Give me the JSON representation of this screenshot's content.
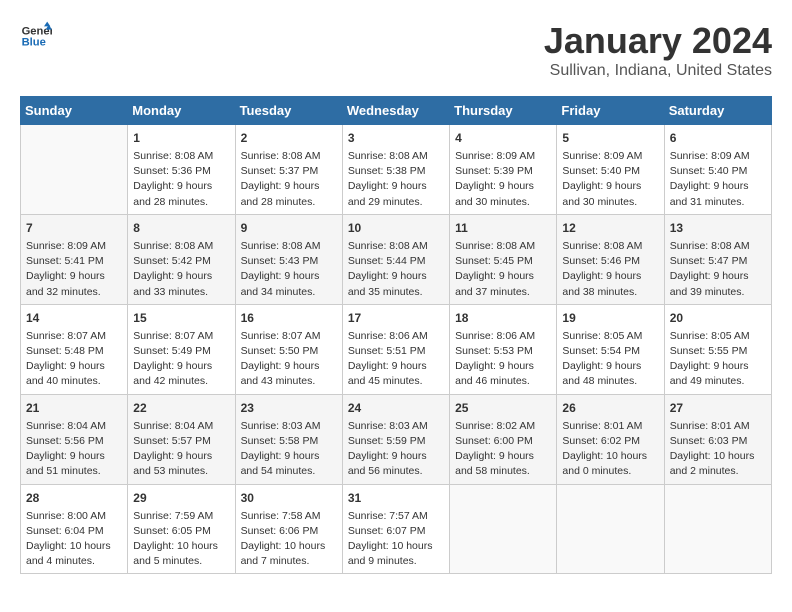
{
  "header": {
    "logo_line1": "General",
    "logo_line2": "Blue",
    "title": "January 2024",
    "subtitle": "Sullivan, Indiana, United States"
  },
  "columns": [
    "Sunday",
    "Monday",
    "Tuesday",
    "Wednesday",
    "Thursday",
    "Friday",
    "Saturday"
  ],
  "weeks": [
    [
      {
        "day": "",
        "info": ""
      },
      {
        "day": "1",
        "info": "Sunrise: 8:08 AM\nSunset: 5:36 PM\nDaylight: 9 hours\nand 28 minutes."
      },
      {
        "day": "2",
        "info": "Sunrise: 8:08 AM\nSunset: 5:37 PM\nDaylight: 9 hours\nand 28 minutes."
      },
      {
        "day": "3",
        "info": "Sunrise: 8:08 AM\nSunset: 5:38 PM\nDaylight: 9 hours\nand 29 minutes."
      },
      {
        "day": "4",
        "info": "Sunrise: 8:09 AM\nSunset: 5:39 PM\nDaylight: 9 hours\nand 30 minutes."
      },
      {
        "day": "5",
        "info": "Sunrise: 8:09 AM\nSunset: 5:40 PM\nDaylight: 9 hours\nand 30 minutes."
      },
      {
        "day": "6",
        "info": "Sunrise: 8:09 AM\nSunset: 5:40 PM\nDaylight: 9 hours\nand 31 minutes."
      }
    ],
    [
      {
        "day": "7",
        "info": "Sunrise: 8:09 AM\nSunset: 5:41 PM\nDaylight: 9 hours\nand 32 minutes."
      },
      {
        "day": "8",
        "info": "Sunrise: 8:08 AM\nSunset: 5:42 PM\nDaylight: 9 hours\nand 33 minutes."
      },
      {
        "day": "9",
        "info": "Sunrise: 8:08 AM\nSunset: 5:43 PM\nDaylight: 9 hours\nand 34 minutes."
      },
      {
        "day": "10",
        "info": "Sunrise: 8:08 AM\nSunset: 5:44 PM\nDaylight: 9 hours\nand 35 minutes."
      },
      {
        "day": "11",
        "info": "Sunrise: 8:08 AM\nSunset: 5:45 PM\nDaylight: 9 hours\nand 37 minutes."
      },
      {
        "day": "12",
        "info": "Sunrise: 8:08 AM\nSunset: 5:46 PM\nDaylight: 9 hours\nand 38 minutes."
      },
      {
        "day": "13",
        "info": "Sunrise: 8:08 AM\nSunset: 5:47 PM\nDaylight: 9 hours\nand 39 minutes."
      }
    ],
    [
      {
        "day": "14",
        "info": "Sunrise: 8:07 AM\nSunset: 5:48 PM\nDaylight: 9 hours\nand 40 minutes."
      },
      {
        "day": "15",
        "info": "Sunrise: 8:07 AM\nSunset: 5:49 PM\nDaylight: 9 hours\nand 42 minutes."
      },
      {
        "day": "16",
        "info": "Sunrise: 8:07 AM\nSunset: 5:50 PM\nDaylight: 9 hours\nand 43 minutes."
      },
      {
        "day": "17",
        "info": "Sunrise: 8:06 AM\nSunset: 5:51 PM\nDaylight: 9 hours\nand 45 minutes."
      },
      {
        "day": "18",
        "info": "Sunrise: 8:06 AM\nSunset: 5:53 PM\nDaylight: 9 hours\nand 46 minutes."
      },
      {
        "day": "19",
        "info": "Sunrise: 8:05 AM\nSunset: 5:54 PM\nDaylight: 9 hours\nand 48 minutes."
      },
      {
        "day": "20",
        "info": "Sunrise: 8:05 AM\nSunset: 5:55 PM\nDaylight: 9 hours\nand 49 minutes."
      }
    ],
    [
      {
        "day": "21",
        "info": "Sunrise: 8:04 AM\nSunset: 5:56 PM\nDaylight: 9 hours\nand 51 minutes."
      },
      {
        "day": "22",
        "info": "Sunrise: 8:04 AM\nSunset: 5:57 PM\nDaylight: 9 hours\nand 53 minutes."
      },
      {
        "day": "23",
        "info": "Sunrise: 8:03 AM\nSunset: 5:58 PM\nDaylight: 9 hours\nand 54 minutes."
      },
      {
        "day": "24",
        "info": "Sunrise: 8:03 AM\nSunset: 5:59 PM\nDaylight: 9 hours\nand 56 minutes."
      },
      {
        "day": "25",
        "info": "Sunrise: 8:02 AM\nSunset: 6:00 PM\nDaylight: 9 hours\nand 58 minutes."
      },
      {
        "day": "26",
        "info": "Sunrise: 8:01 AM\nSunset: 6:02 PM\nDaylight: 10 hours\nand 0 minutes."
      },
      {
        "day": "27",
        "info": "Sunrise: 8:01 AM\nSunset: 6:03 PM\nDaylight: 10 hours\nand 2 minutes."
      }
    ],
    [
      {
        "day": "28",
        "info": "Sunrise: 8:00 AM\nSunset: 6:04 PM\nDaylight: 10 hours\nand 4 minutes."
      },
      {
        "day": "29",
        "info": "Sunrise: 7:59 AM\nSunset: 6:05 PM\nDaylight: 10 hours\nand 5 minutes."
      },
      {
        "day": "30",
        "info": "Sunrise: 7:58 AM\nSunset: 6:06 PM\nDaylight: 10 hours\nand 7 minutes."
      },
      {
        "day": "31",
        "info": "Sunrise: 7:57 AM\nSunset: 6:07 PM\nDaylight: 10 hours\nand 9 minutes."
      },
      {
        "day": "",
        "info": ""
      },
      {
        "day": "",
        "info": ""
      },
      {
        "day": "",
        "info": ""
      }
    ]
  ]
}
